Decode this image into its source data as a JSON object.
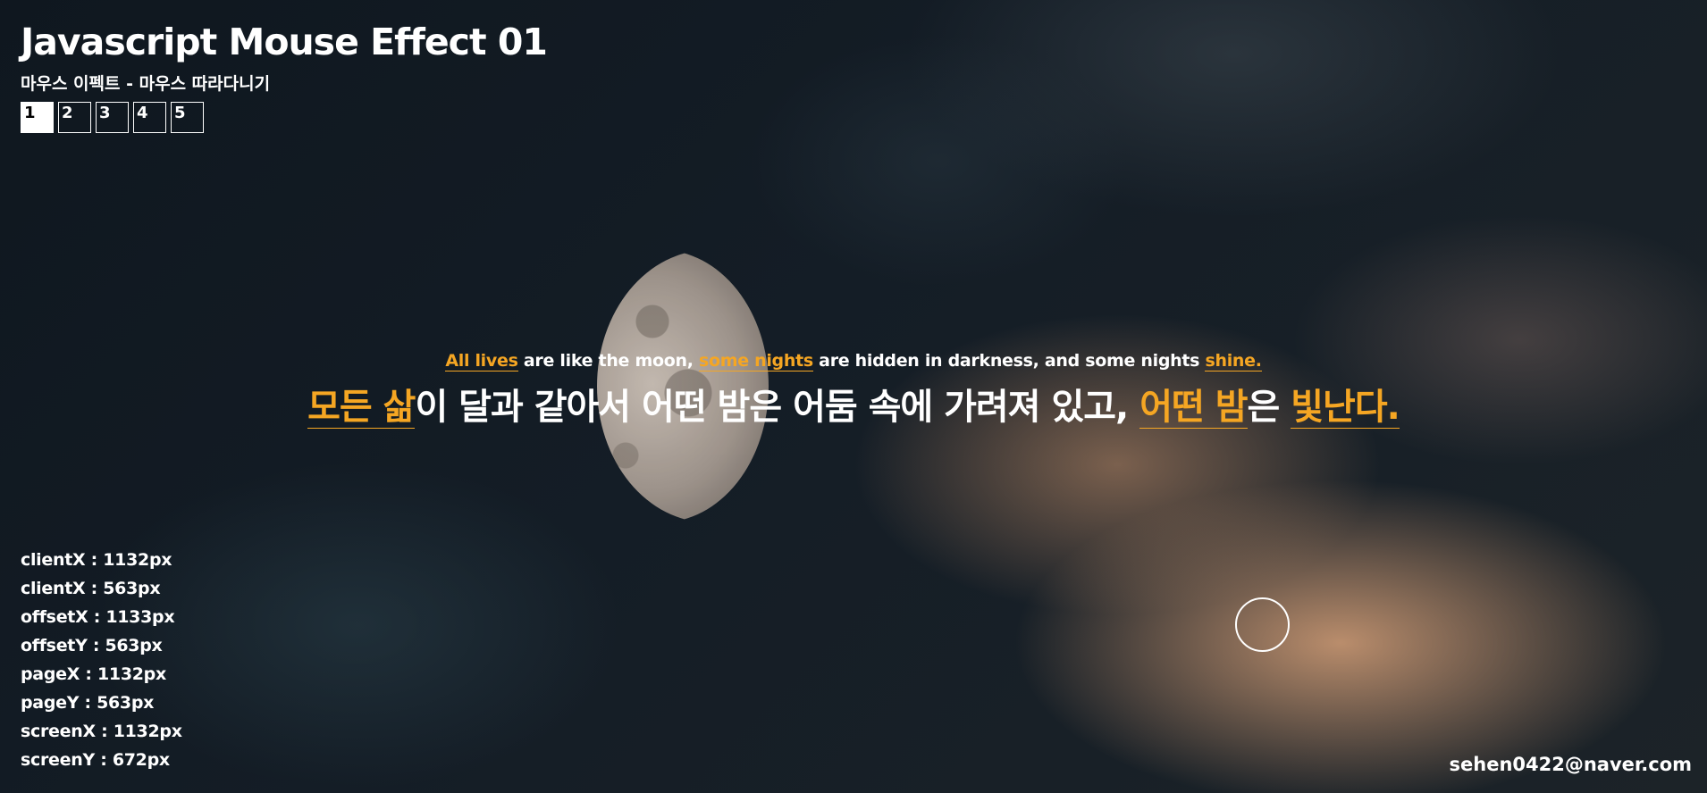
{
  "header": {
    "title": "Javascript Mouse Effect 01",
    "subtitle": "마우스 이펙트 - 마우스 따라다니기",
    "pages": [
      "1",
      "2",
      "3",
      "4",
      "5"
    ],
    "active_page": "1"
  },
  "quote": {
    "en": [
      {
        "text": "All lives",
        "highlight": true
      },
      {
        "text": " are like the moon, ",
        "highlight": false
      },
      {
        "text": "some nights",
        "highlight": true
      },
      {
        "text": " are hidden in darkness, and some nights ",
        "highlight": false
      },
      {
        "text": "shine.",
        "highlight": true
      }
    ],
    "ko": [
      {
        "text": "모든 삶",
        "highlight": true
      },
      {
        "text": "이 달과 같아서 어떤 밤은 어둠 속에 가려져 있고, ",
        "highlight": false
      },
      {
        "text": "어떤 밤",
        "highlight": true
      },
      {
        "text": "은 ",
        "highlight": false
      },
      {
        "text": "빛난다.",
        "highlight": true
      }
    ]
  },
  "coords": [
    "clientX : 1132px",
    "clientX : 563px",
    "offsetX : 1133px",
    "offsetY : 563px",
    "pageX : 1132px",
    "pageY : 563px",
    "screenX : 1132px",
    "screenY : 672px"
  ],
  "footer": {
    "email": "sehen0422@naver.com"
  },
  "colors": {
    "highlight": "#f5a623",
    "text": "#ffffff"
  }
}
